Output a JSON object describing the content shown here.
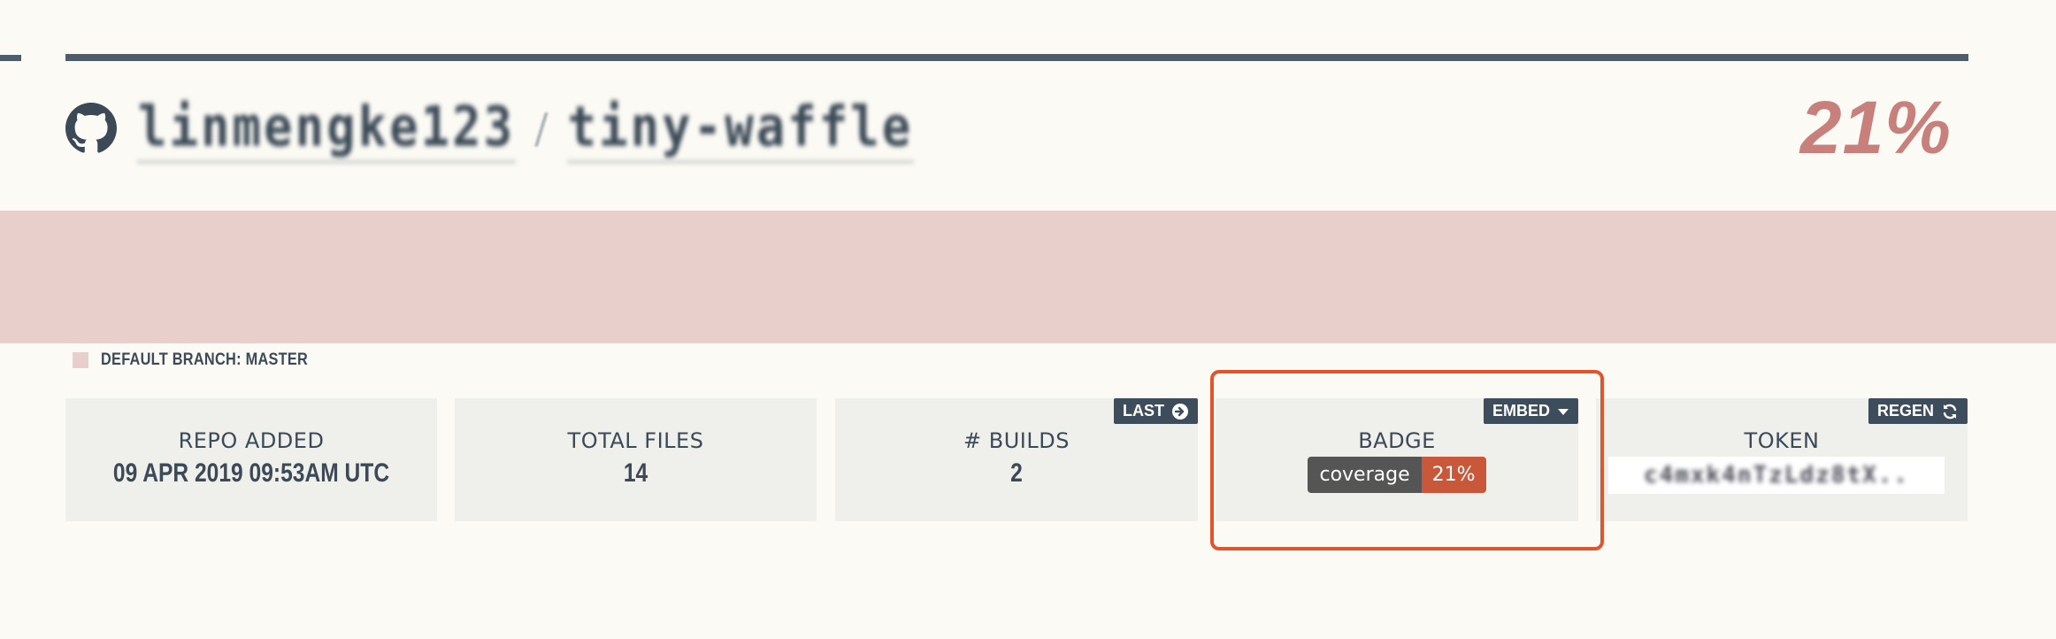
{
  "header": {
    "owner": "linmengke123",
    "separator": "/",
    "repo": "tiny-waffle",
    "coverage": "21%"
  },
  "branch": {
    "label": "DEFAULT BRANCH: MASTER",
    "coverage_fraction": 0.21
  },
  "stats": {
    "repo_added": {
      "label": "REPO ADDED",
      "value": "09 APR 2019 09:53AM UTC"
    },
    "total_files": {
      "label": "TOTAL FILES",
      "value": "14"
    },
    "builds": {
      "label": "# BUILDS",
      "value": "2",
      "tag": "LAST"
    },
    "badge": {
      "label": "BADGE",
      "tag": "EMBED",
      "badge_left": "coverage",
      "badge_right": "21%"
    },
    "token": {
      "label": "TOKEN",
      "tag": "REGEN",
      "value": "c4mxk4nTzLdz8tX.."
    }
  },
  "icons": {
    "repo": "github-icon",
    "last": "arrow-circle-right-icon",
    "embed": "caret-down-icon",
    "regen": "refresh-icon"
  },
  "colors": {
    "coverage_low": "#c8807c",
    "band": "#e8cfcb",
    "tag_bg": "#3e4d5c",
    "badge_grey": "#555555",
    "badge_red": "#c9573a",
    "highlight": "#e2542e"
  }
}
